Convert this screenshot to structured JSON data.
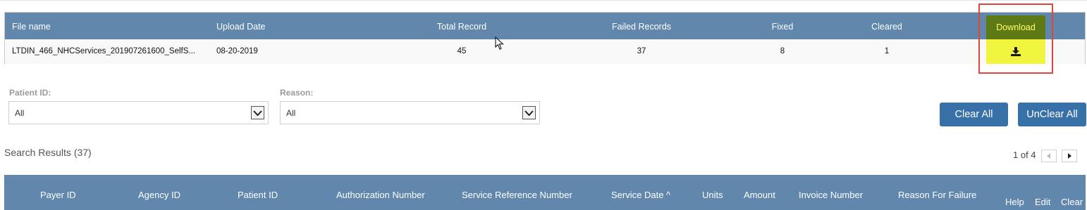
{
  "file_table": {
    "headers": {
      "file_name": "File name",
      "upload_date": "Upload Date",
      "total_record": "Total Record",
      "failed_records": "Failed Records",
      "fixed": "Fixed",
      "cleared": "Cleared",
      "download": "Download"
    },
    "row": {
      "file_name": "LTDIN_466_NHCServices_201907261600_SelfS...",
      "upload_date": "08-20-2019",
      "total_record": "45",
      "failed_records": "37",
      "fixed": "8",
      "cleared": "1",
      "download_icon": "download-icon"
    }
  },
  "filters": {
    "patient_id_label": "Patient ID:",
    "patient_id_value": "All",
    "reason_label": "Reason:",
    "reason_value": "All"
  },
  "actions": {
    "clear_all": "Clear All",
    "unclear_all": "UnClear All"
  },
  "results": {
    "title": "Search Results (37)",
    "pager": "1 of 4",
    "columns": {
      "payer_id": "Payer ID",
      "agency_id": "Agency ID",
      "patient_id": "Patient ID",
      "authorization_number": "Authorization Number",
      "service_reference_number": "Service Reference Number",
      "service_date": "Service Date ^",
      "units": "Units",
      "amount": "Amount",
      "invoice_number": "Invoice Number",
      "reason_for_failure": "Reason For Failure",
      "help": "Help",
      "edit": "Edit",
      "clear": "Clear"
    }
  },
  "colors": {
    "header_blue": "#6187ad",
    "button_blue": "#3771a8",
    "download_header": "#5e7a14",
    "download_cell": "#f2f53d",
    "highlight_red": "#e0453d"
  }
}
